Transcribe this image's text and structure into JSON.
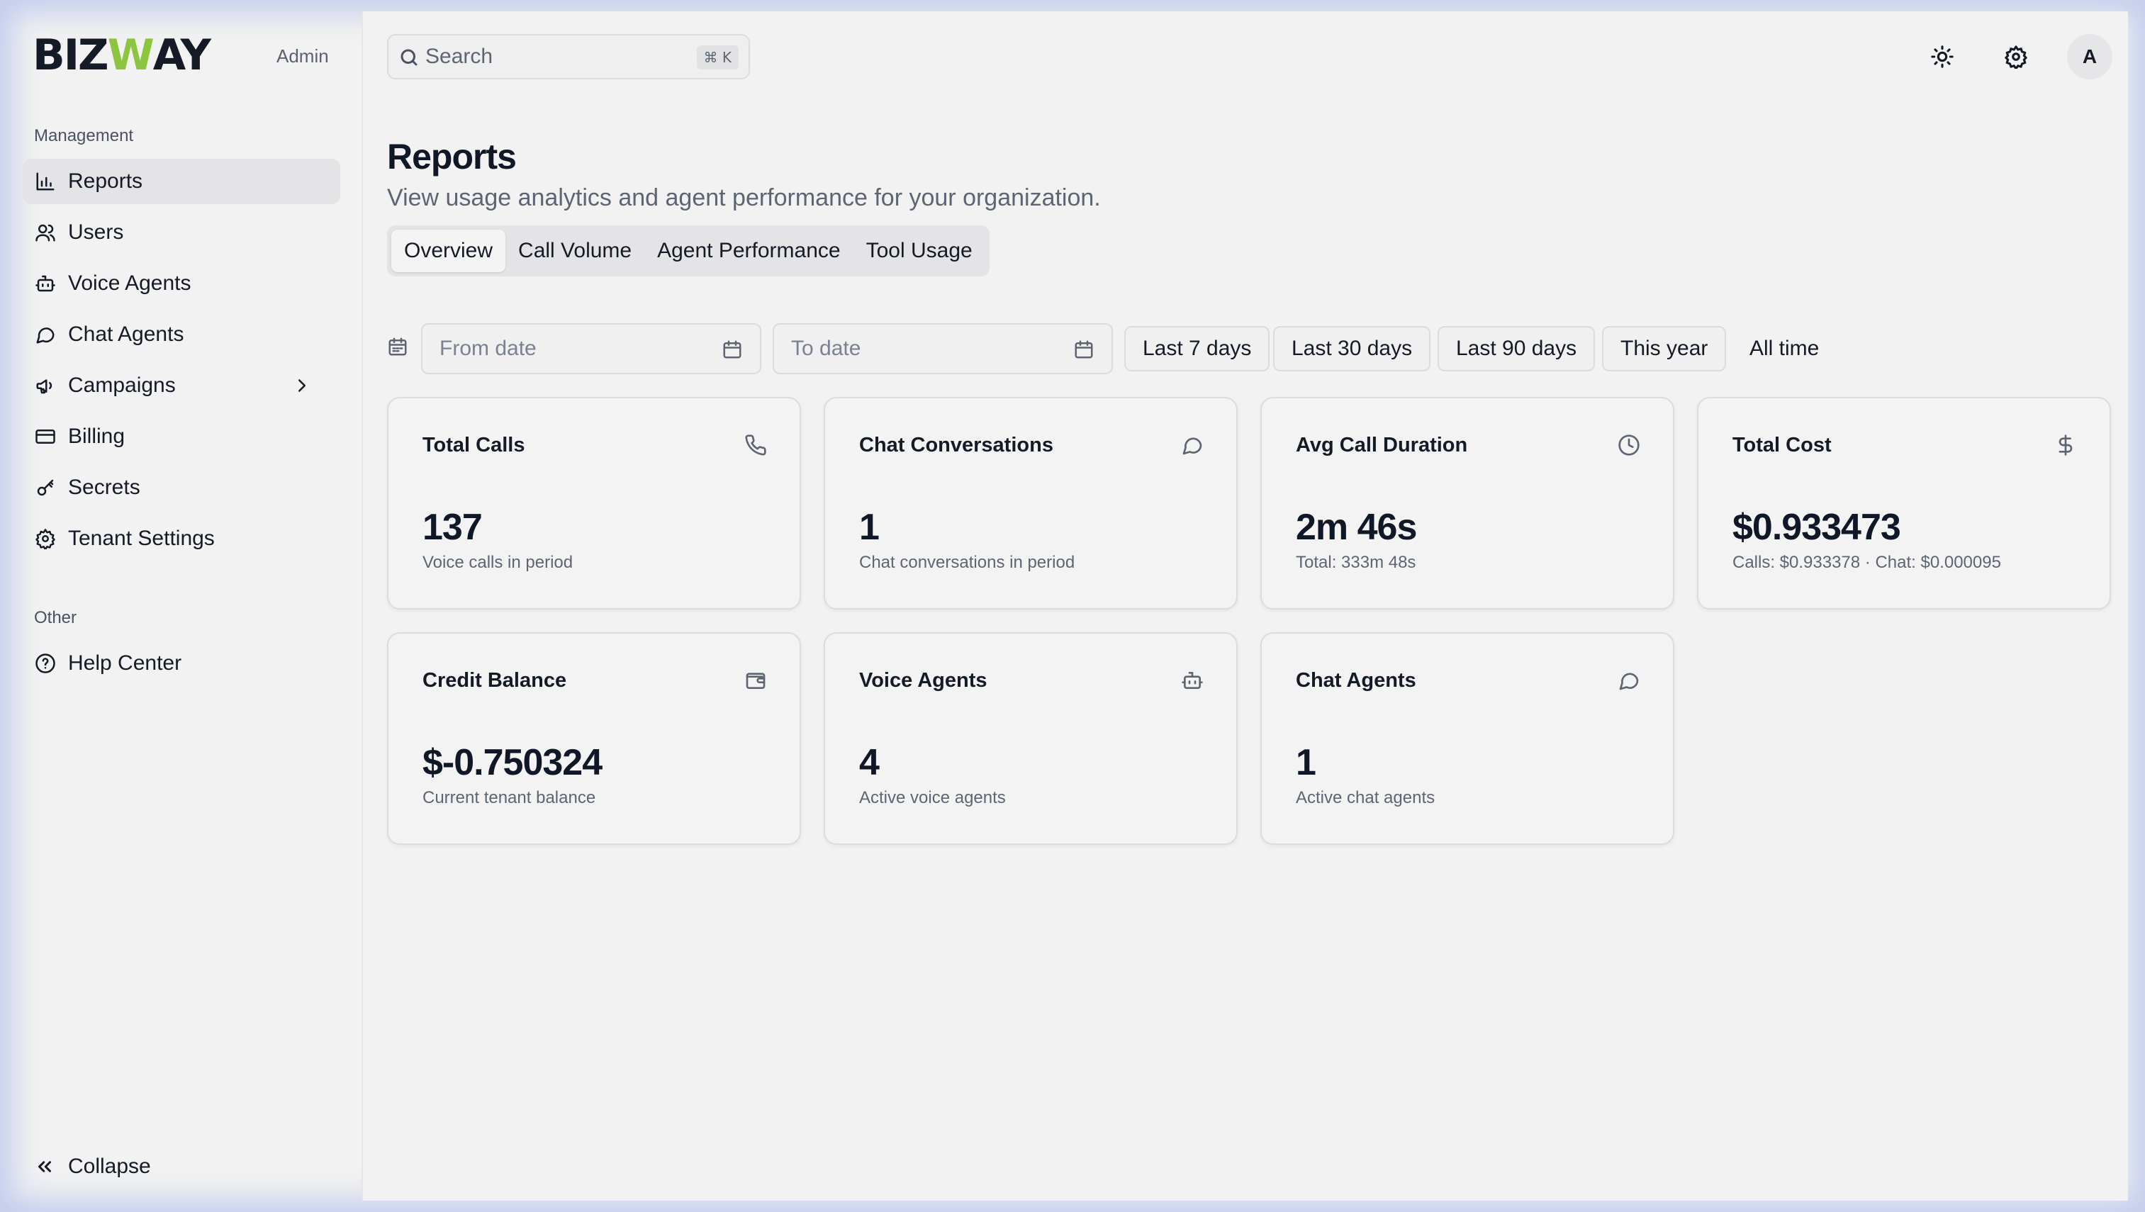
{
  "brand": {
    "logo_pre": "BIZ",
    "logo_w": "W",
    "logo_post": "AY",
    "role": "Admin",
    "accent": "#8cc63f"
  },
  "sidebar": {
    "section_management": "Management",
    "items": [
      {
        "label": "Reports",
        "icon": "bar-chart-icon",
        "active": true
      },
      {
        "label": "Users",
        "icon": "users-icon"
      },
      {
        "label": "Voice Agents",
        "icon": "bot-icon"
      },
      {
        "label": "Chat Agents",
        "icon": "chat-bubble-icon"
      },
      {
        "label": "Campaigns",
        "icon": "megaphone-icon",
        "has_submenu": true
      },
      {
        "label": "Billing",
        "icon": "credit-card-icon"
      },
      {
        "label": "Secrets",
        "icon": "key-icon"
      },
      {
        "label": "Tenant Settings",
        "icon": "gear-icon"
      }
    ],
    "section_other": "Other",
    "help": {
      "label": "Help Center",
      "icon": "help-circle-icon"
    },
    "collapse_label": "Collapse"
  },
  "header": {
    "search_placeholder": "Search",
    "search_shortcut": "⌘ K",
    "avatar_initial": "A"
  },
  "page": {
    "title": "Reports",
    "subtitle": "View usage analytics and agent performance for your organization.",
    "tabs": [
      "Overview",
      "Call Volume",
      "Agent Performance",
      "Tool Usage"
    ],
    "active_tab": "Overview"
  },
  "filters": {
    "from_placeholder": "From date",
    "to_placeholder": "To date",
    "ranges": [
      "Last 7 days",
      "Last 30 days",
      "Last 90 days",
      "This year",
      "All time"
    ]
  },
  "cards": [
    {
      "title": "Total Calls",
      "value": "137",
      "desc": "Voice calls in period",
      "icon": "phone-icon"
    },
    {
      "title": "Chat Conversations",
      "value": "1",
      "desc": "Chat conversations in period",
      "icon": "chat-bubble-icon"
    },
    {
      "title": "Avg Call Duration",
      "value": "2m 46s",
      "desc": "Total: 333m 48s",
      "icon": "clock-icon"
    },
    {
      "title": "Total Cost",
      "value": "$0.933473",
      "desc": "Calls: $0.933378 · Chat: $0.000095",
      "icon": "dollar-icon"
    },
    {
      "title": "Credit Balance",
      "value": "$-0.750324",
      "desc": "Current tenant balance",
      "icon": "wallet-icon"
    },
    {
      "title": "Voice Agents",
      "value": "4",
      "desc": "Active voice agents",
      "icon": "bot-icon"
    },
    {
      "title": "Chat Agents",
      "value": "1",
      "desc": "Active chat agents",
      "icon": "chat-bubble-icon"
    }
  ]
}
